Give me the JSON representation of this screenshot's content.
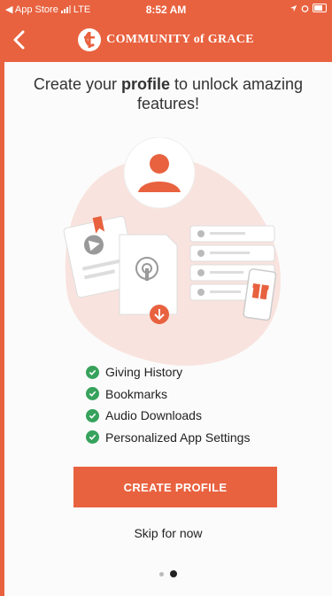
{
  "status_bar": {
    "carrier_back": "◀ App Store",
    "network": "LTE",
    "time": "8:52 AM"
  },
  "nav": {
    "brand": "COMMUNITY of GRACE",
    "brand_color": "#E8623F"
  },
  "headline": {
    "pre": "Create your ",
    "bold": "profile",
    "post": " to unlock amazing features!"
  },
  "features": [
    {
      "label": "Giving History",
      "icon": "check-circle-icon"
    },
    {
      "label": "Bookmarks",
      "icon": "check-circle-icon"
    },
    {
      "label": "Audio Downloads",
      "icon": "check-circle-icon"
    },
    {
      "label": "Personalized App Settings",
      "icon": "check-circle-icon"
    }
  ],
  "cta": {
    "label": "CREATE PROFILE"
  },
  "skip": {
    "label": "Skip for now"
  },
  "pager": {
    "count": 2,
    "active_index": 1
  },
  "colors": {
    "accent": "#E8623F",
    "check": "#37A25C"
  }
}
